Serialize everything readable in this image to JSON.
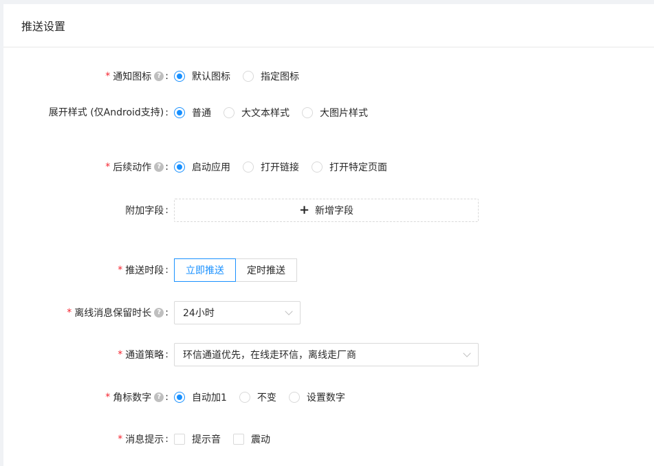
{
  "header": {
    "title": "推送设置"
  },
  "form": {
    "notify_icon": {
      "label": "通知图标",
      "options": [
        "默认图标",
        "指定图标"
      ],
      "selected": 0
    },
    "expand_style": {
      "label_line1": "展开样式",
      "label_line2": "(仅Android支持)",
      "options": [
        "普通",
        "大文本样式",
        "大图片样式"
      ],
      "selected": 0
    },
    "follow_action": {
      "label": "后续动作",
      "options": [
        "启动应用",
        "打开链接",
        "打开特定页面"
      ],
      "selected": 0
    },
    "extra_fields": {
      "label": "附加字段",
      "add_label": "新增字段"
    },
    "push_time": {
      "label": "推送时段",
      "options": [
        "立即推送",
        "定时推送"
      ],
      "selected": 0
    },
    "offline_retention": {
      "label": "离线消息保留时长",
      "value": "24小时"
    },
    "channel_strategy": {
      "label": "通道策略",
      "value": "环信通道优先，在线走环信，离线走厂商"
    },
    "badge_number": {
      "label": "角标数字",
      "options": [
        "自动加1",
        "不变",
        "设置数字"
      ],
      "selected": 0
    },
    "message_alert": {
      "label": "消息提示",
      "options": [
        "提示音",
        "震动"
      ]
    }
  },
  "common": {
    "required_mark": "*",
    "colon": ":",
    "help_glyph": "?"
  },
  "colors": {
    "primary": "#1890ff",
    "required": "#f5222d",
    "border": "#d9d9d9"
  }
}
